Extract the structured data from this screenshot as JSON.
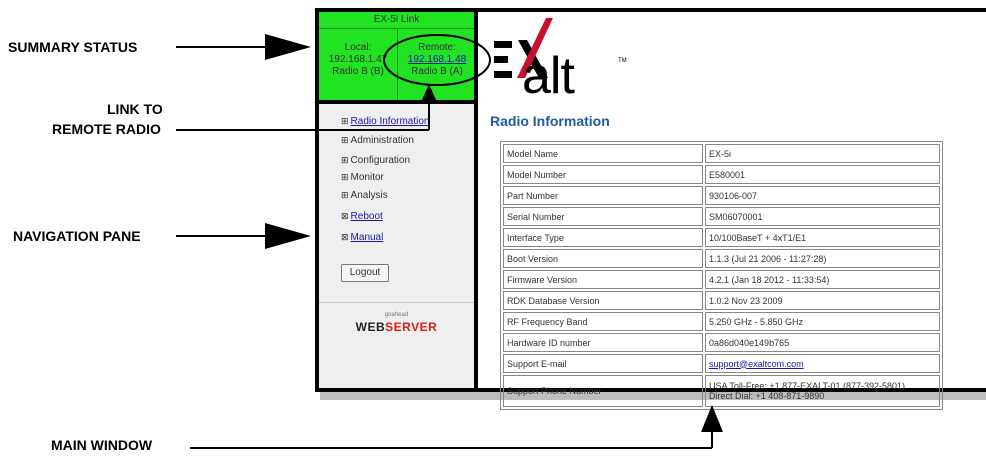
{
  "callouts": {
    "summary_status": "SUMMARY STATUS",
    "link_to_remote_line1": "LINK TO",
    "link_to_remote_line2": "REMOTE RADIO",
    "navigation_pane": "NAVIGATION PANE",
    "main_window": "MAIN WINDOW"
  },
  "summary": {
    "title": "EX-5i Link",
    "local_label": "Local:",
    "local_ip": "192.168.1.47",
    "local_radio": "Radio B (B)",
    "remote_label": "Remote:",
    "remote_ip": "192.168.1.48",
    "remote_radio": "Radio B (A)"
  },
  "nav": {
    "items": [
      {
        "label": "Radio Information",
        "icon": "plus-box-icon",
        "link": true
      },
      {
        "label": "Administration",
        "icon": "plus-box-icon",
        "link": false
      },
      {
        "label": "Configuration",
        "icon": "plus-box-icon",
        "link": false
      },
      {
        "label": "Monitor",
        "icon": "plus-box-icon",
        "link": false
      },
      {
        "label": "Analysis",
        "icon": "plus-box-icon",
        "link": false
      },
      {
        "label": "Reboot",
        "icon": "x-box-icon",
        "link": true
      },
      {
        "label": "Manual",
        "icon": "x-box-icon",
        "link": true
      }
    ],
    "logout_label": "Logout",
    "footer_small": "goahead",
    "footer_web": "WEB",
    "footer_server": "SERVER"
  },
  "logo": {
    "text": "alt",
    "tm": "TM"
  },
  "main": {
    "title": "Radio Information",
    "rows": [
      {
        "key": "Model Name",
        "value": "EX-5i"
      },
      {
        "key": "Model Number",
        "value": "E580001"
      },
      {
        "key": "Part Number",
        "value": "930106-007"
      },
      {
        "key": "Serial Number",
        "value": "SM06070001"
      },
      {
        "key": "Interface Type",
        "value": "10/100BaseT + 4xT1/E1"
      },
      {
        "key": "Boot Version",
        "value": "1.1.3 (Jul 21 2006 - 11:27:28)"
      },
      {
        "key": "Firmware Version",
        "value": "4.2.1 (Jan 18 2012 - 11:33:54)"
      },
      {
        "key": "RDK Database Version",
        "value": "1.0.2 Nov 23 2009"
      },
      {
        "key": "RF Frequency Band",
        "value": "5.250 GHz - 5.850 GHz"
      },
      {
        "key": "Hardware ID number",
        "value": "0a86d040e149b765"
      },
      {
        "key": "Support E-mail",
        "value": "support@exaltcom.com"
      },
      {
        "key": "Support Phone Number",
        "value": "USA Toll-Free: +1 877-EXALT-01 (877-392-5801)",
        "value2": "Direct Dial: +1 408-871-9890"
      }
    ]
  },
  "colors": {
    "summary_green": "#21e321",
    "title_blue": "#1f5aa6",
    "link_blue": "#1a1aa6",
    "logo_red": "#c8102e"
  }
}
